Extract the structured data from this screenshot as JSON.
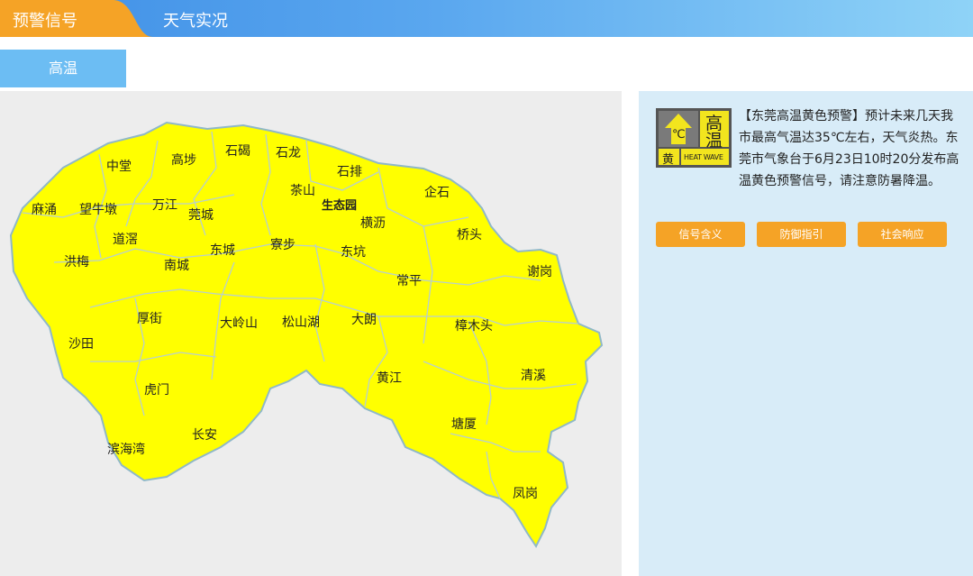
{
  "tabs": {
    "warning_label": "预警信号",
    "weather_label": "天气实况"
  },
  "subtab": {
    "label": "高温"
  },
  "map": {
    "towns": [
      {
        "name": "中堂"
      },
      {
        "name": "高埗"
      },
      {
        "name": "石碣"
      },
      {
        "name": "石龙"
      },
      {
        "name": "石排"
      },
      {
        "name": "茶山"
      },
      {
        "name": "生态园"
      },
      {
        "name": "企石"
      },
      {
        "name": "麻涌"
      },
      {
        "name": "望牛墩"
      },
      {
        "name": "万江"
      },
      {
        "name": "莞城"
      },
      {
        "name": "横沥"
      },
      {
        "name": "道滘"
      },
      {
        "name": "东城"
      },
      {
        "name": "寮步"
      },
      {
        "name": "东坑"
      },
      {
        "name": "桥头"
      },
      {
        "name": "洪梅"
      },
      {
        "name": "南城"
      },
      {
        "name": "谢岗"
      },
      {
        "name": "常平"
      },
      {
        "name": "厚街"
      },
      {
        "name": "大岭山"
      },
      {
        "name": "松山湖"
      },
      {
        "name": "大朗"
      },
      {
        "name": "樟木头"
      },
      {
        "name": "沙田"
      },
      {
        "name": "黄江"
      },
      {
        "name": "清溪"
      },
      {
        "name": "虎门"
      },
      {
        "name": "塘厦"
      },
      {
        "name": "长安"
      },
      {
        "name": "滨海湾"
      },
      {
        "name": "凤岗"
      }
    ],
    "fill_color": "#ffff00",
    "boundary_color": "#8fb8c8"
  },
  "signal": {
    "main_char_1": "高",
    "main_char_2": "温",
    "level": "黄",
    "english": "HEAT WAVE",
    "unit": "℃",
    "color": "#f2e51e"
  },
  "warning": {
    "text": "【东莞高温黄色预警】预计未来几天我市最高气温达35℃左右，天气炎热。东莞市气象台于6月23日10时20分发布高温黄色预警信号，请注意防暑降温。"
  },
  "buttons": {
    "meaning": "信号含义",
    "guide": "防御指引",
    "response": "社会响应"
  }
}
